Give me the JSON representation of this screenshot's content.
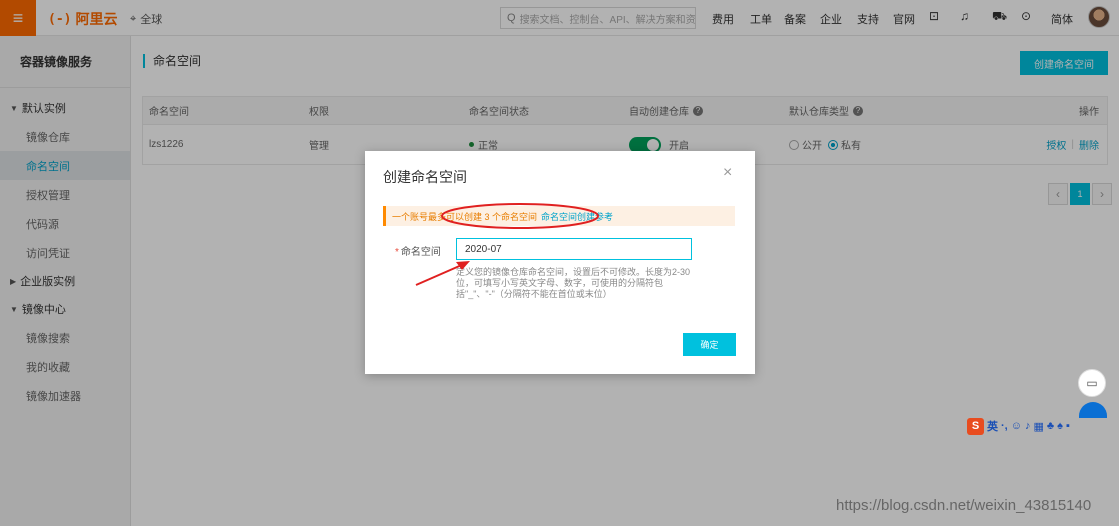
{
  "topbar": {
    "logo_text": "阿里云",
    "logo_mark": "(-)",
    "region": "全球",
    "search_placeholder": "搜索文档、控制台、API、解决方案和资源",
    "nav": [
      "费用",
      "工单",
      "备案",
      "企业",
      "支持",
      "官网"
    ],
    "language": "简体"
  },
  "sidebar": {
    "title": "容器镜像服务",
    "groups": [
      {
        "label": "默认实例",
        "expanded": true,
        "items": [
          "镜像仓库",
          "命名空间",
          "授权管理",
          "代码源",
          "访问凭证"
        ]
      },
      {
        "label": "企业版实例",
        "expanded": false,
        "items": []
      },
      {
        "label": "镜像中心",
        "expanded": true,
        "items": [
          "镜像搜索",
          "我的收藏",
          "镜像加速器"
        ]
      }
    ],
    "active_item": "命名空间"
  },
  "main": {
    "page_title": "命名空间",
    "create_button": "创建命名空间",
    "table": {
      "headers": [
        "命名空间",
        "权限",
        "命名空间状态",
        "自动创建仓库",
        "默认仓库类型",
        "操作"
      ],
      "row": {
        "name": "lzs1226",
        "permission": "管理",
        "status": "正常",
        "auto_create": "开启",
        "repo_type_options": [
          "公开",
          "私有"
        ],
        "repo_type_selected": "私有",
        "actions": [
          "授权",
          "删除"
        ]
      }
    },
    "pager": {
      "current": "1",
      "prev": "‹",
      "next": "›"
    }
  },
  "dialog": {
    "title": "创建命名空间",
    "close": "×",
    "notice_text": "一个账号最多可以创建 3 个命名空间",
    "notice_link": "命名空间创建参考",
    "field_label": "命名空间",
    "field_value": "2020-07",
    "field_help": "定义您的镜像仓库命名空间，设置后不可修改。长度为2-30位，可填写小写英文字母、数字，可使用的分隔符包括\"_\"、\"-\"（分隔符不能在首位或末位）",
    "ok_button": "确定"
  },
  "ime": {
    "label": "英"
  },
  "watermark": "https://blog.csdn.net/weixin_43815140",
  "colors": {
    "brand": "#ff6a00",
    "accent": "#00c1de",
    "link": "#00a2ca",
    "annotation": "#e02020"
  }
}
